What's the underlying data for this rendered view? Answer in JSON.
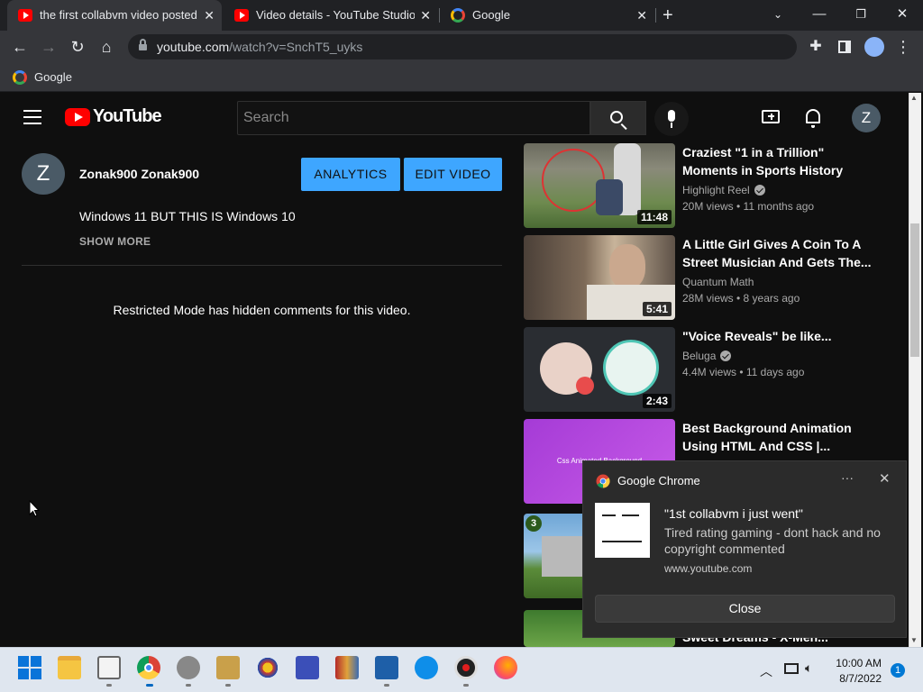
{
  "browser": {
    "tabs": [
      {
        "title": "the first collabvm video posted e",
        "favicon": "youtube-icon",
        "active": true
      },
      {
        "title": "Video details - YouTube Studio",
        "favicon": "youtube-icon",
        "active": false
      },
      {
        "title": "Google",
        "favicon": "google-icon",
        "active": false
      }
    ],
    "new_tab": "+",
    "url_host": "youtube.com",
    "url_path": "/watch?v=SnchT5_uyks",
    "bookmark": "Google"
  },
  "youtube": {
    "logo_text": "YouTube",
    "search_placeholder": "Search",
    "user_initial": "Z"
  },
  "video": {
    "channel_initial": "Z",
    "channel_name": "Zonak900 Zonak900",
    "analytics_label": "ANALYTICS",
    "edit_label": "EDIT VIDEO",
    "description": "Windows 11 BUT THIS IS Windows 10",
    "show_more": "SHOW MORE",
    "comments_notice": "Restricted Mode has hidden comments for this video."
  },
  "related": [
    {
      "title": "Craziest \"1 in a Trillion\" Moments in Sports History",
      "channel": "Highlight Reel",
      "verified": true,
      "meta": "20M views • 11 months ago",
      "duration": "11:48"
    },
    {
      "title": "A Little Girl Gives A Coin To A Street Musician And Gets The...",
      "channel": "Quantum Math",
      "verified": false,
      "meta": "28M views • 8 years ago",
      "duration": "5:41"
    },
    {
      "title": "\"Voice Reveals\" be like...",
      "channel": "Beluga",
      "verified": true,
      "meta": "4.4M views • 11 days ago",
      "duration": "2:43"
    },
    {
      "title": "Best Background Animation Using HTML And CSS |...",
      "channel": "",
      "verified": false,
      "meta": "",
      "duration": "",
      "thumb_text": "Css Animated Background"
    },
    {
      "title": "",
      "channel": "",
      "verified": false,
      "meta": "",
      "duration": "",
      "badge": "3"
    },
    {
      "title": "Sweet Dreams - X-Men...",
      "channel": "",
      "verified": false,
      "meta": "",
      "duration": ""
    }
  ],
  "notification": {
    "app": "Google Chrome",
    "title": "\"1st collabvm i just went\"",
    "body": "Tired rating gaming - dont hack and no copyright commented",
    "url": "www.youtube.com",
    "close_label": "Close",
    "more": "···"
  },
  "taskbar": {
    "time": "10:00 AM",
    "date": "8/7/2022",
    "badge_count": "1"
  },
  "colors": {
    "accent_blue": "#3ea6ff",
    "youtube_red": "#ff0000",
    "background": "#0f0f0f"
  }
}
